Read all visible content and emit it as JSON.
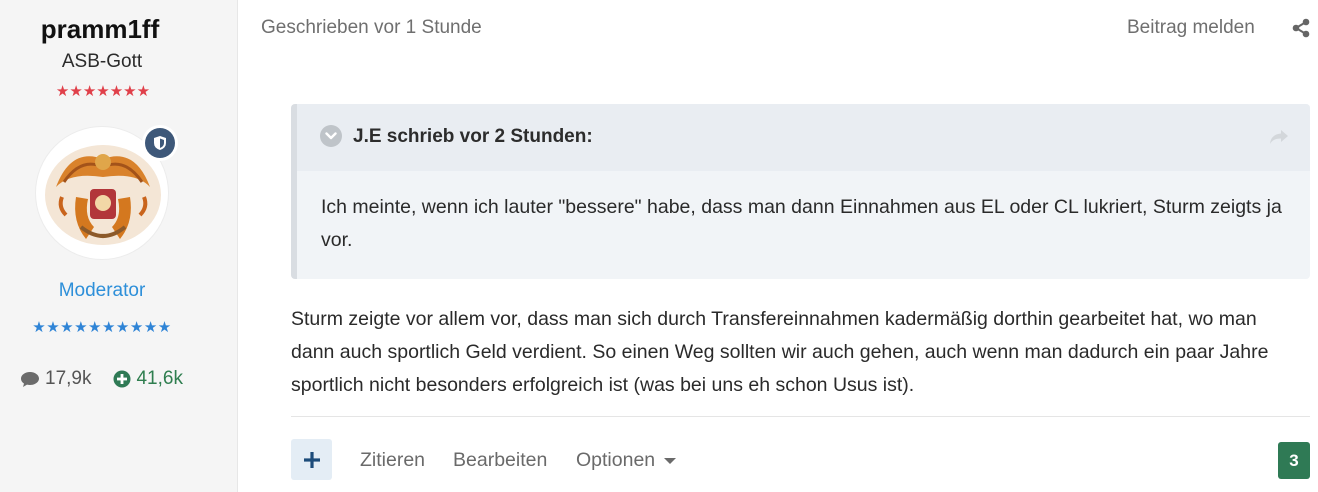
{
  "author": {
    "name": "pramm1ff",
    "rank_title": "ASB-Gott",
    "rank_stars": "★★★★★★★",
    "group": "Moderator",
    "group_stars": "★★★★★★★★★★",
    "posts_count": "17,9k",
    "reputation": "41,6k",
    "icons": {
      "posts": "comment-icon",
      "reputation": "plus-circle-icon",
      "moderator_badge": "shield-icon",
      "avatar": "queen-crest-avatar"
    }
  },
  "post": {
    "date": "Geschrieben vor 1 Stunde",
    "report_label": "Beitrag melden",
    "share_icon": "share-icon",
    "quote": {
      "author_line": "J.E schrieb vor 2 Stunden:",
      "text": "Ich meinte, wenn ich lauter \"bessere\" habe, dass man dann Einnahmen aus EL oder CL lukriert, Sturm zeigts ja vor."
    },
    "body": "Sturm zeigte vor allem vor, dass man sich durch Transfereinnahmen kadermäßig dorthin gearbeitet hat, wo man dann auch sportlich Geld verdient. So einen Weg sollten wir auch gehen, auch wenn man dadurch ein paar Jahre sportlich nicht besonders erfolgreich ist (was bei uns eh schon Usus ist).",
    "actions": {
      "plus_label": "+",
      "quote_label": "Zitieren",
      "edit_label": "Bearbeiten",
      "options_label": "Optionen"
    },
    "reputation_count": "3"
  },
  "colors": {
    "group_blue": "#2d8fd9",
    "rep_green": "#2f7a55",
    "stars_red": "#e0404a",
    "badge_navy": "#3e5879"
  }
}
